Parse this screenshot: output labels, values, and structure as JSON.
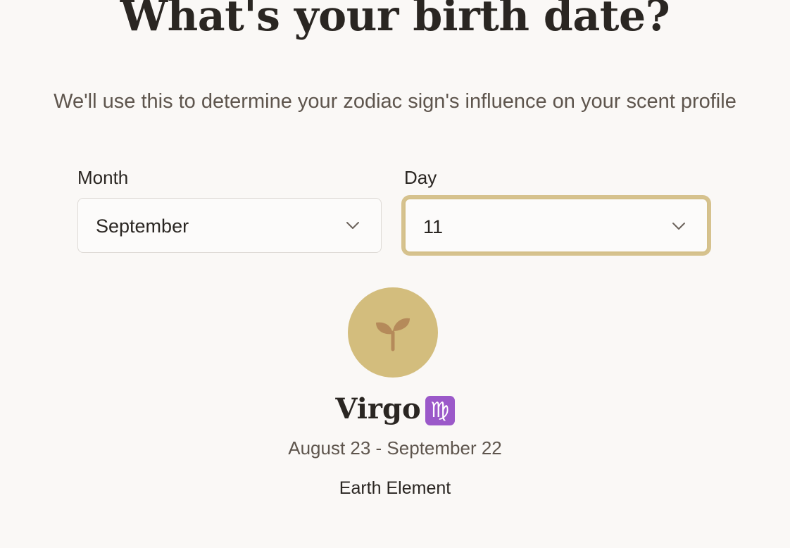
{
  "heading": "What's your birth date?",
  "subtitle": "We'll use this to determine your zodiac sign's influence on your scent profile",
  "form": {
    "month_label": "Month",
    "month_value": "September",
    "day_label": "Day",
    "day_value": "11"
  },
  "result": {
    "icon": "sprout-icon",
    "sign_name": "Virgo",
    "sign_glyph": "♍",
    "date_range": "August 23 - September 22",
    "element": "Earth Element"
  },
  "colors": {
    "background": "#faf8f6",
    "accent_gold": "#d3bd7d",
    "focus_ring": "#d6c28e",
    "sprout": "#b58a5a",
    "text_dark": "#2a2622",
    "text_muted": "#5e554d"
  }
}
